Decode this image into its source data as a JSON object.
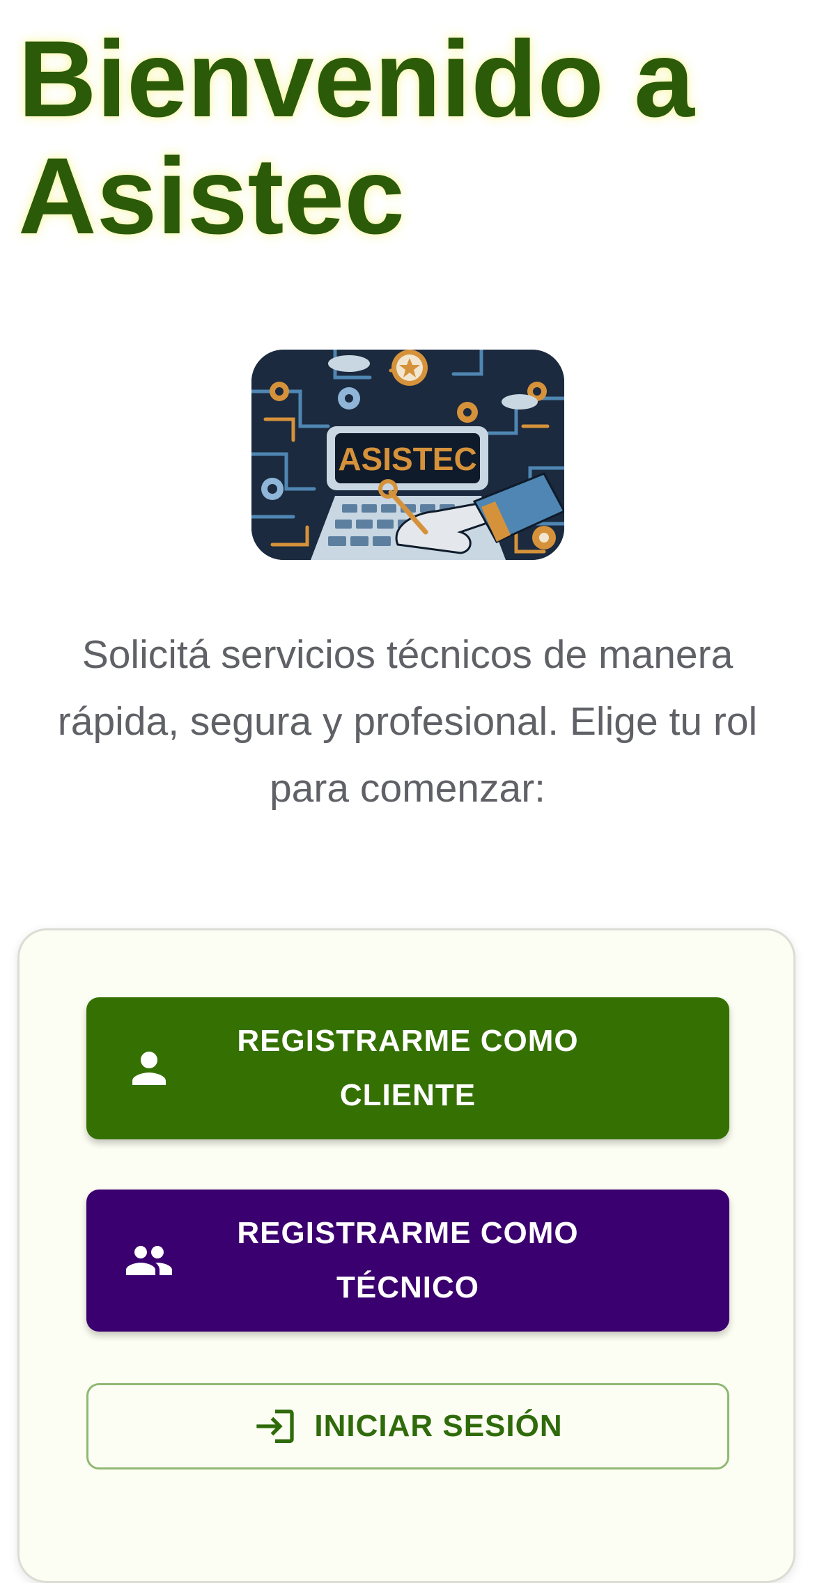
{
  "header": {
    "title": "Bienvenido a Asistec"
  },
  "logo": {
    "text": "ASISTEC",
    "icon": "asistec-logo-image"
  },
  "intro": {
    "tagline": "Solicitá servicios técnicos de manera rápida, segura y profesional. Elige tu rol para comenzar:"
  },
  "actions": {
    "register_client": {
      "label": "REGISTRARME COMO CLIENTE",
      "icon": "person-icon",
      "color": "#357102"
    },
    "register_technician": {
      "label": "REGISTRARME COMO TÉCNICO",
      "icon": "people-icon",
      "color": "#3b006f"
    },
    "login": {
      "label": "INICIAR SESIÓN",
      "icon": "login-icon",
      "color": "#2f6b0b"
    }
  },
  "colors": {
    "title": "#2b5a09",
    "card_background": "#fdfef3",
    "text_muted": "#5f6166"
  }
}
